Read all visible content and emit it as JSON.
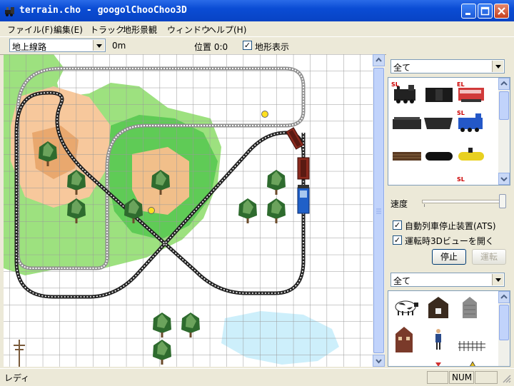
{
  "window": {
    "title": "terrain.cho - googolChooChoo3D"
  },
  "menu": [
    "ファイル(F)",
    "編集(E)",
    "トラック",
    "地形景観",
    "ウィンドウ",
    "ヘルプ(H)"
  ],
  "toolbar": {
    "layer_select": "地上線路",
    "height": "0m",
    "position": "位置 0:0",
    "terrain_display_checked": "✓",
    "terrain_display_label": "地形表示"
  },
  "train_palette": {
    "filter": "全て",
    "badges": {
      "sl": "SL",
      "el": "EL"
    }
  },
  "controls": {
    "speed_label": "速度",
    "ats_checked": "✓",
    "ats_label": "自動列車停止装置(ATS)",
    "view3d_checked": "✓",
    "view3d_label": "運転時3Dビューを開く",
    "stop_button": "停止",
    "run_button": "運転"
  },
  "object_palette": {
    "filter": "全て"
  },
  "status": {
    "text": "レディ",
    "num": "NUM"
  }
}
